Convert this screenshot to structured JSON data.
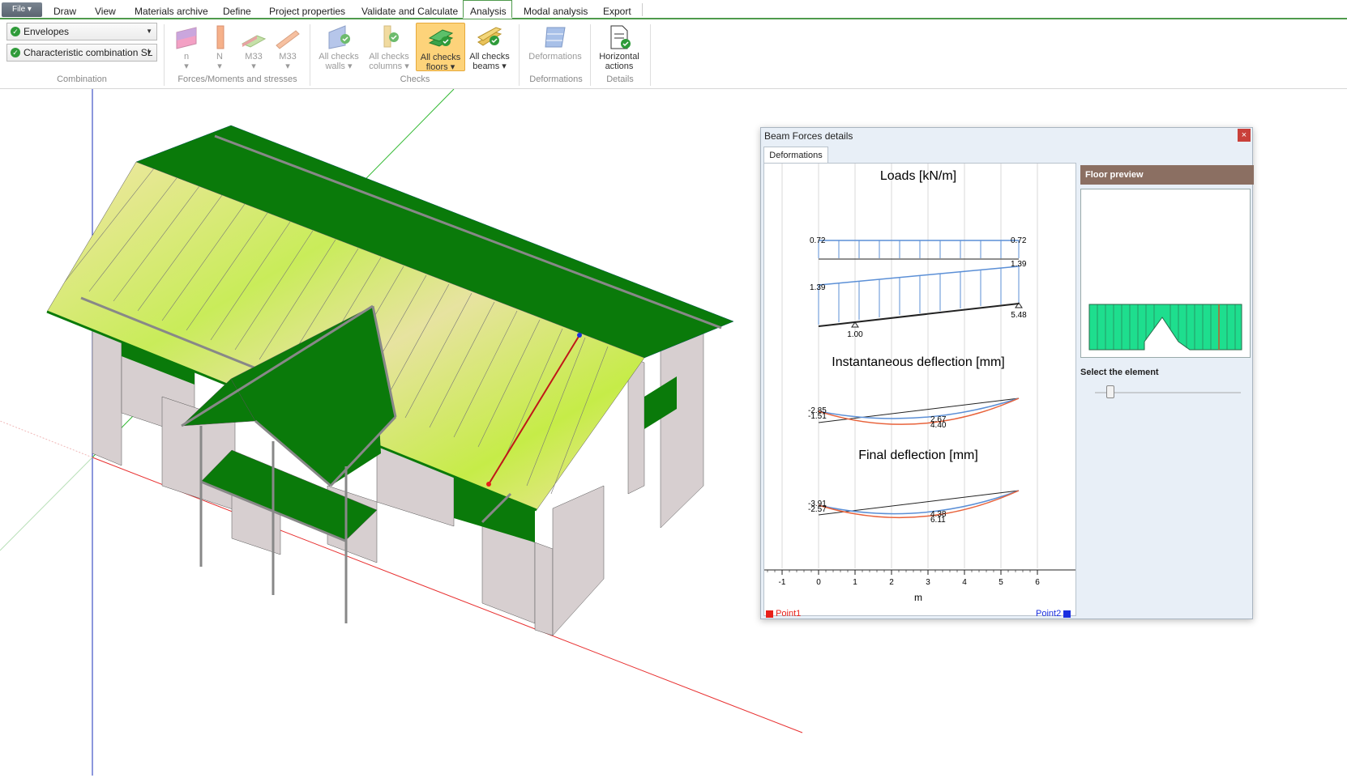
{
  "menu": {
    "file_label": "File ▾",
    "tabs": [
      "Draw",
      "View",
      "Materials archive",
      "Define",
      "Project properties",
      "Validate and Calculate",
      "Analysis",
      "Modal analysis",
      "Export"
    ],
    "active_tab": "Analysis"
  },
  "ribbon": {
    "combination": {
      "envelopes_label": "Envelopes",
      "combination_label": "Characteristic combination SL",
      "group_label": "Combination"
    },
    "forces": {
      "buttons": [
        "n",
        "N",
        "M33",
        "M33"
      ],
      "group_label": "Forces/Moments and stresses"
    },
    "checks": {
      "walls_line1": "All checks",
      "walls_line2": "walls ▾",
      "columns_line1": "All checks",
      "columns_line2": "columns ▾",
      "floors_line1": "All checks",
      "floors_line2": "floors ▾",
      "beams_line1": "All checks",
      "beams_line2": "beams ▾",
      "group_label": "Checks"
    },
    "deformations": {
      "button_label": "Deformations",
      "group_label": "Deformations"
    },
    "details": {
      "line1": "Horizontal",
      "line2": "actions",
      "group_label": "Details"
    }
  },
  "dialog": {
    "title": "Beam Forces details",
    "close_label": "×",
    "tab_label": "Deformations",
    "loads_title": "Loads [kN/m]",
    "instant_title": "Instantaneous deflection [mm]",
    "final_title": "Final deflection [mm]",
    "load_labels": {
      "top_left": "0.72",
      "top_right": "0.72",
      "bot_left": "1.39",
      "bot_right": "1.39",
      "support_left": "1.00",
      "support_right": "5.48"
    },
    "instant_labels": {
      "a": "-2.85",
      "b": "-1.51",
      "c": "2.67",
      "d": "4.40"
    },
    "final_labels": {
      "a": "-3.91",
      "b": "-2.57",
      "c": "4.38",
      "d": "6.11"
    },
    "x_ticks": [
      "-1",
      "0",
      "1",
      "2",
      "3",
      "4",
      "5",
      "6"
    ],
    "x_axis_label": "m",
    "point1_label": "Point1",
    "point2_label": "Point2",
    "floor_preview_label": "Floor preview",
    "select_element_label": "Select the element",
    "colors": {
      "point1": "#e8201a",
      "point2": "#1a2fe0",
      "instant_curve": "#e8623a",
      "final_curve": "#5b8fd6",
      "load_arrow": "#5b8fd6"
    }
  }
}
